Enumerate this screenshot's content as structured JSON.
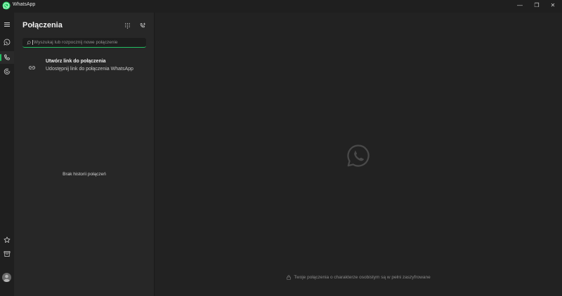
{
  "window": {
    "title": "WhatsApp",
    "minimize_symbol": "—",
    "restore_symbol": "❐",
    "close_symbol": "✕"
  },
  "rail": {
    "items": [
      {
        "icon": "menu-icon"
      },
      {
        "icon": "chats-icon"
      },
      {
        "icon": "calls-icon",
        "active": true
      },
      {
        "icon": "status-icon"
      },
      {
        "icon": "starred-icon"
      },
      {
        "icon": "archive-icon"
      },
      {
        "icon": "settings-icon"
      },
      {
        "icon": "profile-avatar"
      }
    ]
  },
  "calls_panel": {
    "title": "Połączenia",
    "dialpad_icon": "dialpad-icon",
    "new_call_icon": "new-call-icon",
    "search": {
      "placeholder": "Wyszukaj lub rozpocznij nowe połączenie",
      "value": ""
    },
    "create_link": {
      "title": "Utwórz link do połączenia",
      "subtitle": "Udostępnij link do połączenia WhatsApp",
      "icon": "link-icon"
    },
    "empty_text": "Brak historii połączeń"
  },
  "main": {
    "encrypted_notice": "Twoje połączenia o charakterze osobistym są w pełni zaszyfrowane"
  },
  "colors": {
    "accent": "#21c063",
    "background": "#222222",
    "panel": "#272727",
    "rail": "#1f1f1f"
  }
}
